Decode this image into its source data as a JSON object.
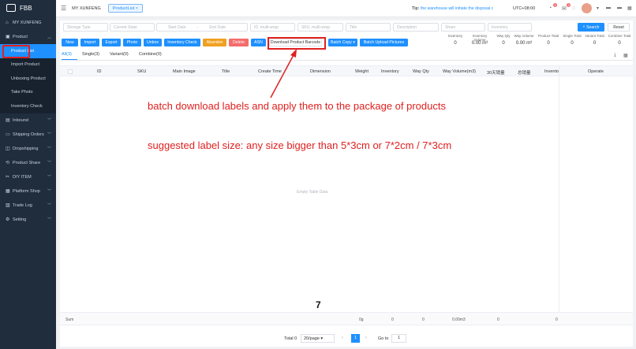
{
  "sidebar": {
    "logo": "FBB",
    "top_item": "MY XUNFENG",
    "product_group": "Product",
    "product_subs": [
      "Product List",
      "Import Product",
      "Unboxing Product",
      "Take Photo",
      "Inventory Check"
    ],
    "groups": [
      "Inbound",
      "Shipping Orders",
      "Dropshipping",
      "Product Share",
      "DIY ITEM",
      "Platform Shop",
      "Trade Log",
      "Setting"
    ]
  },
  "topbar": {
    "store": "MY XUNFENG",
    "tab": "ProductList",
    "tip_label": "Tip:",
    "tip_text": "the warehouse will initiate the disposal c",
    "timezone": "UTC+08:00",
    "badge1": "1",
    "badge2": "2"
  },
  "filters": {
    "storage_type": "Storage Type",
    "current_state": "Current State",
    "start_date": "Start Date",
    "dash": "-",
    "end_date": "End Date",
    "id_multi": "ID, multi-wrap",
    "sku_multi": "SKU, multi-wrap",
    "title": "Title",
    "description": "Description",
    "share": "Share",
    "inventory": "Inventory",
    "search": "Search",
    "reset": "Reset"
  },
  "actions": [
    "New",
    "Import",
    "Export",
    "Photo",
    "Unbox",
    "Inventory Check",
    "Abandon",
    "Delete",
    "ASN",
    "Download Product Barcode",
    "Batch Copy",
    "Batch Upload Pictures"
  ],
  "stats": {
    "labels": [
      "Inventory",
      "Inventory Volume",
      "Way Qty",
      "Way Volume",
      "Product Total",
      "Single Total",
      "Variant Total",
      "Combine Total"
    ],
    "values": [
      "0",
      "0.00 m³",
      "0",
      "0.00 m³",
      "0",
      "0",
      "0",
      "0"
    ]
  },
  "tabs": [
    "All(3)",
    "Single(3)",
    "Variant(0)",
    "Combine(0)"
  ],
  "table": {
    "headers": [
      "ID",
      "SKU",
      "Main Image",
      "Title",
      "Create Time",
      "Dimension",
      "Weight",
      "Inventory",
      "Way Qty",
      "Way Volume(m3)",
      "30天销量",
      "总销量",
      "Invento",
      "Operate"
    ],
    "empty": "Empty Table Data",
    "sum_label": "Sum",
    "sum_values": [
      "0g",
      "0",
      "0",
      "0.00m3",
      "0",
      "0"
    ]
  },
  "pager": {
    "total": "Total 0",
    "per_page": "20/page",
    "page": "1",
    "goto_label": "Go to",
    "goto_value": "1"
  },
  "annotation": {
    "line1": "batch download labels and apply them to the package of products",
    "line2": "suggested label size: any size bigger than 5*3cm or 7*2cm / 7*3cm",
    "number": "7"
  }
}
